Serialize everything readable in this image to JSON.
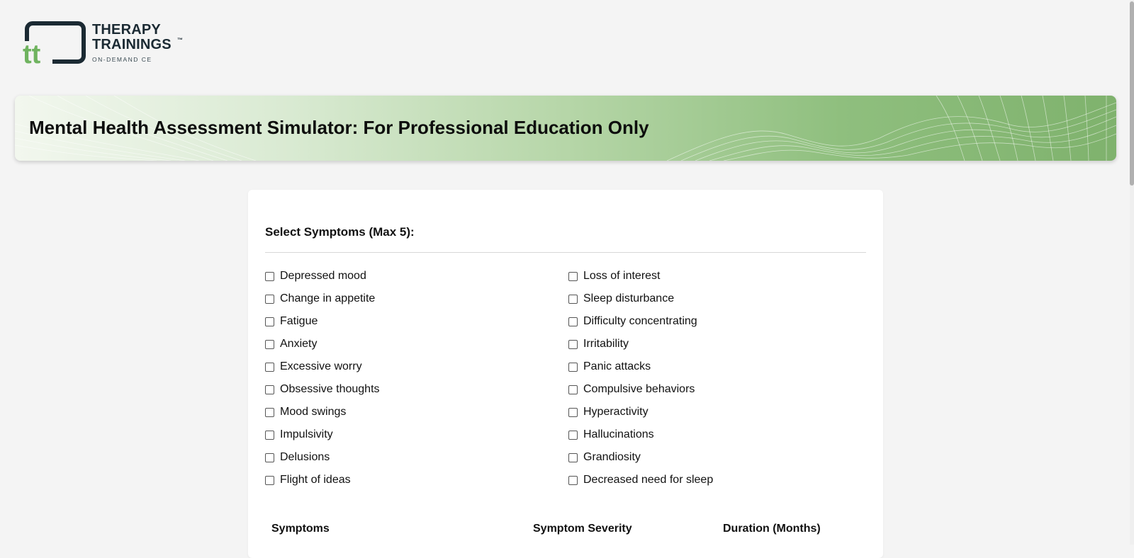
{
  "logo": {
    "line1": "THERAPY",
    "line2": "TRAININGS",
    "trademark": "™",
    "tagline": "ON-DEMAND CE",
    "mark": "tt"
  },
  "banner": {
    "title": "Mental Health Assessment Simulator: For Professional Education Only"
  },
  "form": {
    "section_title": "Select Symptoms (Max 5):",
    "symptoms": [
      "Depressed mood",
      "Loss of interest",
      "Change in appetite",
      "Sleep disturbance",
      "Fatigue",
      "Difficulty concentrating",
      "Anxiety",
      "Irritability",
      "Excessive worry",
      "Panic attacks",
      "Obsessive thoughts",
      "Compulsive behaviors",
      "Mood swings",
      "Hyperactivity",
      "Impulsivity",
      "Hallucinations",
      "Delusions",
      "Grandiosity",
      "Flight of ideas",
      "Decreased need for sleep"
    ],
    "checked": [
      false,
      false,
      false,
      false,
      false,
      false,
      false,
      false,
      false,
      false,
      false,
      false,
      false,
      false,
      false,
      false,
      false,
      false,
      false,
      false
    ]
  },
  "table": {
    "headers": [
      "Symptoms",
      "Symptom Severity",
      "Duration (Months)"
    ]
  },
  "colors": {
    "brand_dark": "#1b2a33",
    "brand_green": "#6fb35f",
    "banner_green": "#7fb26d"
  }
}
